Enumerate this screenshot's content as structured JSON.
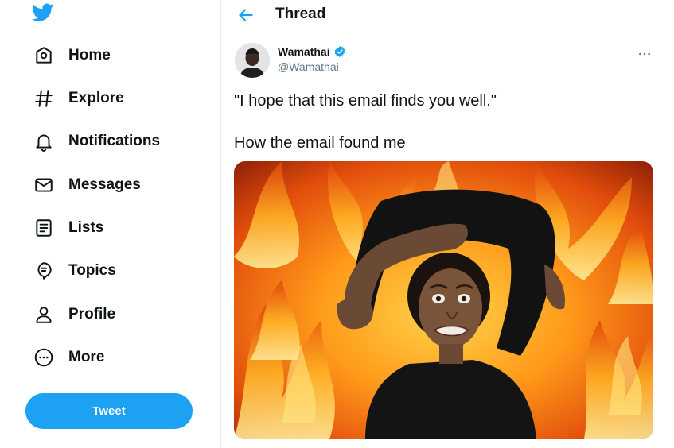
{
  "sidebar": {
    "logo_icon": "twitter-bird-icon",
    "items": [
      {
        "label": "Home",
        "icon": "home-icon"
      },
      {
        "label": "Explore",
        "icon": "hashtag-icon"
      },
      {
        "label": "Notifications",
        "icon": "bell-icon"
      },
      {
        "label": "Messages",
        "icon": "envelope-icon"
      },
      {
        "label": "Lists",
        "icon": "list-icon"
      },
      {
        "label": "Topics",
        "icon": "topics-icon"
      },
      {
        "label": "Profile",
        "icon": "person-icon"
      },
      {
        "label": "More",
        "icon": "more-circle-icon"
      }
    ],
    "tweet_button_label": "Tweet"
  },
  "header": {
    "title": "Thread",
    "back_icon": "back-arrow-icon"
  },
  "tweet": {
    "author": {
      "name": "Wamathai",
      "handle": "@Wamathai",
      "verified": true
    },
    "text_line_1": "\"I hope that this email finds you well.\"",
    "text_line_2": "How the email found me",
    "more_icon": "more-horizontal-icon",
    "media_description_icon": "meme-image"
  },
  "colors": {
    "accent": "#1da1f2",
    "text_primary": "#0f1419",
    "text_secondary": "#657786",
    "border": "#e6ecf0"
  }
}
